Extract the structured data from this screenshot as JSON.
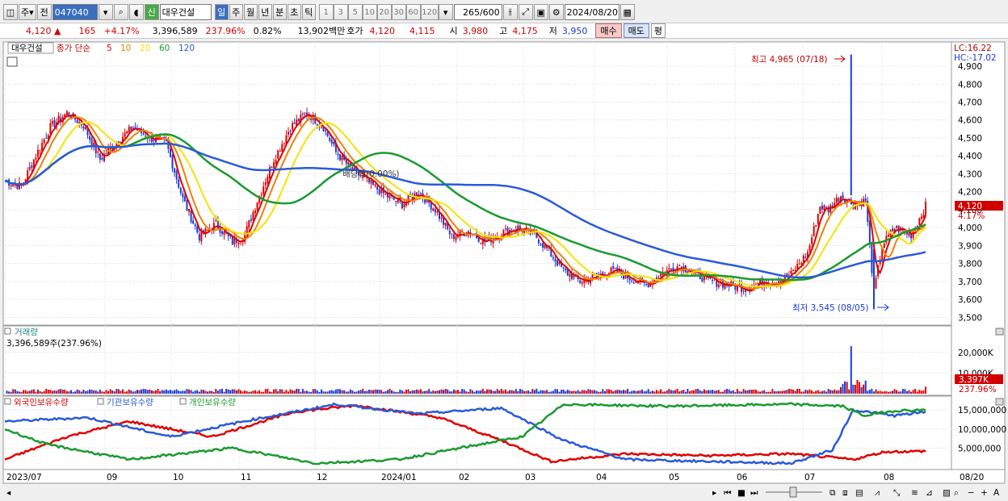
{
  "toolbar": {
    "market_type": "주",
    "prev_label": "전",
    "stock_code": "047040",
    "new_label": "신",
    "stock_name": "대우건설",
    "period_tabs": [
      "일",
      "주",
      "월",
      "년",
      "분",
      "초",
      "틱"
    ],
    "active_period": "일",
    "intervals": [
      "1",
      "3",
      "5",
      "10",
      "20",
      "30",
      "60",
      "120"
    ],
    "count_value": "265",
    "count_total": "/600",
    "date": "2024/08/20"
  },
  "quote": {
    "price": "4,120",
    "change_arrow": "▲",
    "change": "165",
    "change_pct": "+4.17%",
    "volume": "3,396,589",
    "volume_ratio": "237.96%",
    "turnover": "0.82%",
    "amount": "13,902백만",
    "ask_label": "호가",
    "ask": "4,120",
    "bid": "4,115",
    "open_label": "시",
    "open": "3,980",
    "high_label": "고",
    "high": "4,175",
    "low_label": "저",
    "low": "3,950",
    "buy_label": "매수",
    "sell_label": "매도",
    "eval_label": "평"
  },
  "price_panel": {
    "stock_tag": "대우건설",
    "ma_title": "종가 단순",
    "ma_periods": [
      "5",
      "10",
      "20",
      "60",
      "120"
    ],
    "ma_colors": [
      "#e00000",
      "#f08000",
      "#f5e400",
      "#1a9a30",
      "#2a5ad8"
    ],
    "lc_label": "LC:16.22",
    "hc_label": "HC:-17.02",
    "max_label": "최고 4,965 (07/18)",
    "min_label": "최저 3,545 (08/05)",
    "rights_label": "배당락(0.00%)",
    "last_price_tag": "4,120",
    "last_pct_tag": "4.17%",
    "y_ticks": [
      "4,900",
      "4,800",
      "4,700",
      "4,600",
      "4,500",
      "4,400",
      "4,300",
      "4,200",
      "4,100",
      "4,000",
      "3,900",
      "3,800",
      "3,700",
      "3,600",
      "3,500"
    ]
  },
  "volume_panel": {
    "title": "거래량",
    "value_label": "3,396,589주(237.96%)",
    "y_ticks": [
      "20,000K",
      "10,000K"
    ],
    "last_tag": "3,397K",
    "last_pct_tag": "237.96%"
  },
  "holding_panel": {
    "series": [
      {
        "name": "외국인보유수량",
        "color": "#e00000"
      },
      {
        "name": "기관보유수량",
        "color": "#2a5ad8"
      },
      {
        "name": "개인보유수량",
        "color": "#1a9a30"
      }
    ],
    "y_ticks": [
      "15,000,000",
      "10,000,000",
      "5,000,000"
    ]
  },
  "x_axis": {
    "labels": [
      "2023/07",
      "09",
      "10",
      "11",
      "12",
      "2024/01",
      "02",
      "03",
      "04",
      "05",
      "06",
      "07",
      "08"
    ],
    "end_label": "08/20"
  }
}
